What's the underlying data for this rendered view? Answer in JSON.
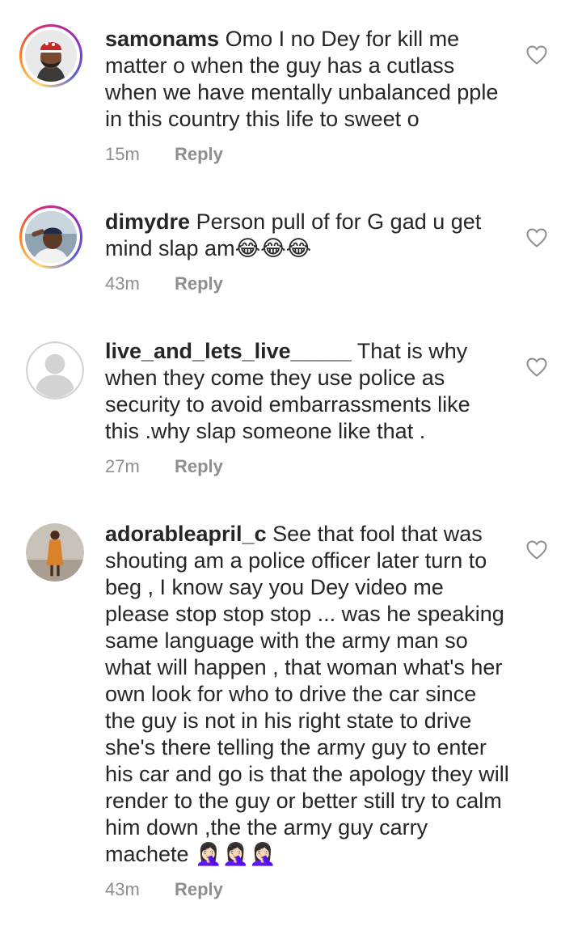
{
  "comments": [
    {
      "username": "samonams",
      "text": "Omo I no Dey for kill me matter o when the guy has a cutlass when we have mentally unbalanced pple in this country this life to sweet o",
      "time": "15m",
      "reply_label": "Reply",
      "avatar_story_ring": true,
      "avatar_icon": "profile-photo-man-red-cap"
    },
    {
      "username": "dimydre",
      "text": "Person pull of for G gad u get mind slap am😂😂😂",
      "time": "43m",
      "reply_label": "Reply",
      "avatar_story_ring": true,
      "avatar_icon": "profile-photo-man-salute"
    },
    {
      "username": "live_and_lets_live_____",
      "text": "That is why when they come they use police as security to avoid embarrassments like this .why slap someone like that .",
      "time": "27m",
      "reply_label": "Reply",
      "avatar_story_ring": false,
      "avatar_icon": "default-avatar-icon"
    },
    {
      "username": "adorableapril_c",
      "text": "See that fool that was shouting am a police officer later turn to beg , I know say you Dey video me please stop stop stop ... was he speaking same language with the army man so what will happen , that woman what's her own look for who to drive the car since the guy is not in his right state to drive she's there telling the army guy to enter his car and go is that the apology they will render to the guy or better still try  to calm him down ,the the army guy carry machete 🤦🏻‍♀️🤦🏻‍♀️🤦🏻‍♀️",
      "time": "43m",
      "reply_label": "Reply",
      "avatar_story_ring": false,
      "avatar_icon": "profile-photo-woman-orange-dress"
    }
  ],
  "colors": {
    "text": "#262626",
    "meta": "#8e8e8e",
    "heart": "#8e8e8e"
  }
}
